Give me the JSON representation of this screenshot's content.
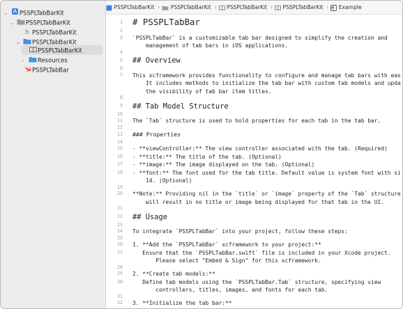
{
  "sidebar": {
    "items": [
      {
        "label": "PSSPLTabBarKit",
        "icon": "project-blue-icon",
        "chevron": "open"
      },
      {
        "label": "PSSPLTabBarKit",
        "icon": "folder-icon",
        "chevron": "open"
      },
      {
        "label": "PSSPLTabBarKit",
        "icon": "header-file-icon",
        "chevron": ""
      },
      {
        "label": "PSSPLTabBarKit",
        "icon": "docc-catalog-icon",
        "chevron": "open"
      },
      {
        "label": "PSSPLTabBarKit",
        "icon": "book-icon",
        "chevron": "",
        "selected": true
      },
      {
        "label": "Resources",
        "icon": "folder-icon",
        "chevron": "closed"
      },
      {
        "label": "PSSPLTabBar",
        "icon": "swift-icon",
        "chevron": ""
      }
    ]
  },
  "jumpbar": {
    "crumbs": [
      "PSSPLTabBarKit",
      "PSSPLTabBarKit",
      "PSSPLTabBarKit",
      "PSSPLTabBarKit",
      "Example"
    ]
  },
  "editor": {
    "lines": [
      {
        "num": "1",
        "style": "h1",
        "text": "# PSSPLTabBar"
      },
      {
        "num": "2",
        "style": "",
        "text": ""
      },
      {
        "num": "3",
        "style": "",
        "text": "`PSSPLTabBar` is a customizable tab bar designed to simplify the creation and"
      },
      {
        "num": "",
        "style": "",
        "text": "    management of tab bars in iOS applications."
      },
      {
        "num": "4",
        "style": "",
        "text": ""
      },
      {
        "num": "5",
        "style": "h2",
        "text": "## Overview"
      },
      {
        "num": "6",
        "style": "",
        "text": ""
      },
      {
        "num": "7",
        "style": "",
        "text": "This xcframework provides functionality to configure and manage tab bars with ease."
      },
      {
        "num": "",
        "style": "",
        "text": "    It includes methods to initialize the tab bar with custom tab models and update"
      },
      {
        "num": "",
        "style": "",
        "text": "    the visibility of tab bar item titles."
      },
      {
        "num": "8",
        "style": "",
        "text": ""
      },
      {
        "num": "9",
        "style": "h2",
        "text": "## Tab Model Structure"
      },
      {
        "num": "10",
        "style": "",
        "text": ""
      },
      {
        "num": "11",
        "style": "",
        "text": "The `Tab` structure is used to hold properties for each tab in the tab bar."
      },
      {
        "num": "12",
        "style": "",
        "text": ""
      },
      {
        "num": "13",
        "style": "h3",
        "text": "### Properties"
      },
      {
        "num": "14",
        "style": "",
        "text": ""
      },
      {
        "num": "15",
        "style": "",
        "text": "- **viewController:** The view controller associated with the tab. (Required)"
      },
      {
        "num": "16",
        "style": "",
        "text": "- **title:** The title of the tab. (Optional)"
      },
      {
        "num": "17",
        "style": "",
        "text": "- **image:** The image displayed on the tab. (Optional)"
      },
      {
        "num": "18",
        "style": "",
        "text": "- **font:** The font used for the tab title. Default value is system font with size"
      },
      {
        "num": "",
        "style": "",
        "text": "    14. (Optional)"
      },
      {
        "num": "19",
        "style": "",
        "text": ""
      },
      {
        "num": "20",
        "style": "",
        "text": "**Note:** Providing nil in the `title` or `image` property of the `Tab` structure"
      },
      {
        "num": "",
        "style": "",
        "text": "    will result in no title or image being displayed for that tab in the UI."
      },
      {
        "num": "21",
        "style": "",
        "text": ""
      },
      {
        "num": "22",
        "style": "h2",
        "text": "## Usage"
      },
      {
        "num": "23",
        "style": "",
        "text": ""
      },
      {
        "num": "24",
        "style": "",
        "text": "To integrate `PSSPLTabBar` into your project, follow these steps:"
      },
      {
        "num": "25",
        "style": "",
        "text": ""
      },
      {
        "num": "26",
        "style": "",
        "text": "1. **Add the `PSSPLTabBar` xcframework to your project:**"
      },
      {
        "num": "27",
        "style": "",
        "text": "   Ensure that the `PSSPLTabBar.swift` file is included in your Xcode project."
      },
      {
        "num": "",
        "style": "",
        "text": "       Please select \"Embed & Sign\" for this xcframework."
      },
      {
        "num": "28",
        "style": "",
        "text": ""
      },
      {
        "num": "29",
        "style": "",
        "text": "2. **Create tab models:**"
      },
      {
        "num": "30",
        "style": "",
        "text": "   Define tab models using the `PSSPLTabBar.Tab` structure, specifying view"
      },
      {
        "num": "",
        "style": "",
        "text": "       controllers, titles, images, and fonts for each tab."
      },
      {
        "num": "31",
        "style": "",
        "text": ""
      },
      {
        "num": "32",
        "style": "",
        "text": "3. **Initialize the tab bar:**"
      }
    ]
  }
}
